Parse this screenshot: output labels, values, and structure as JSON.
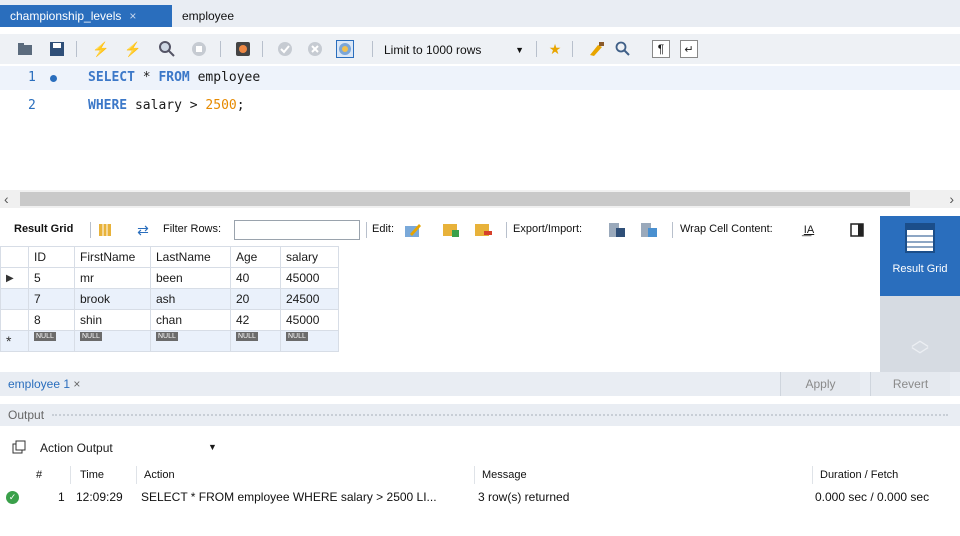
{
  "tabs": [
    {
      "label": "championship_levels",
      "active": true
    },
    {
      "label": "employee",
      "active": false
    }
  ],
  "toolbar": {
    "limit_label": "Limit to 1000 rows",
    "icons": [
      "folder-icon",
      "save-icon",
      "lightning-icon",
      "lightning-cursor-icon",
      "magnify-explain-icon",
      "stop-icon",
      "stop-on-error-icon",
      "commit-icon",
      "rollback-icon",
      "autocommit-icon",
      "bookmark-star-icon",
      "brush-icon",
      "search-icon",
      "invisible-chars-icon",
      "wrap-icon"
    ]
  },
  "editor": {
    "lines": [
      {
        "num": "1",
        "kw1": "SELECT",
        "mid": " * ",
        "kw2": "FROM",
        "rest": " employee"
      },
      {
        "num": "2",
        "kw1": "WHERE",
        "mid": " salary > ",
        "num_lit": "2500",
        "rest": ";"
      }
    ]
  },
  "result_toolbar": {
    "result_grid": "Result Grid",
    "filter_rows": "Filter Rows:",
    "filter_value": "",
    "edit": "Edit:",
    "export_import": "Export/Import:",
    "wrap_cell": "Wrap Cell Content:"
  },
  "grid": {
    "columns": [
      "ID",
      "FirstName",
      "LastName",
      "Age",
      "salary"
    ],
    "rows": [
      [
        "5",
        "mr",
        "been",
        "40",
        "45000"
      ],
      [
        "7",
        "brook",
        "ash",
        "20",
        "24500"
      ],
      [
        "8",
        "shin",
        "chan",
        "42",
        "45000"
      ]
    ],
    "null_label": "NULL"
  },
  "side_panel": {
    "result_grid_label": "Result Grid"
  },
  "result_tab": {
    "label": "employee 1",
    "apply": "Apply",
    "revert": "Revert"
  },
  "output": {
    "title": "Output",
    "selector": "Action Output",
    "headers": {
      "num": "#",
      "time": "Time",
      "action": "Action",
      "message": "Message",
      "duration": "Duration / Fetch"
    },
    "rows": [
      {
        "num": "1",
        "time": "12:09:29",
        "action": "SELECT * FROM employee WHERE salary > 2500 LI...",
        "message": "3 row(s) returned",
        "duration": "0.000 sec / 0.000 sec"
      }
    ]
  }
}
